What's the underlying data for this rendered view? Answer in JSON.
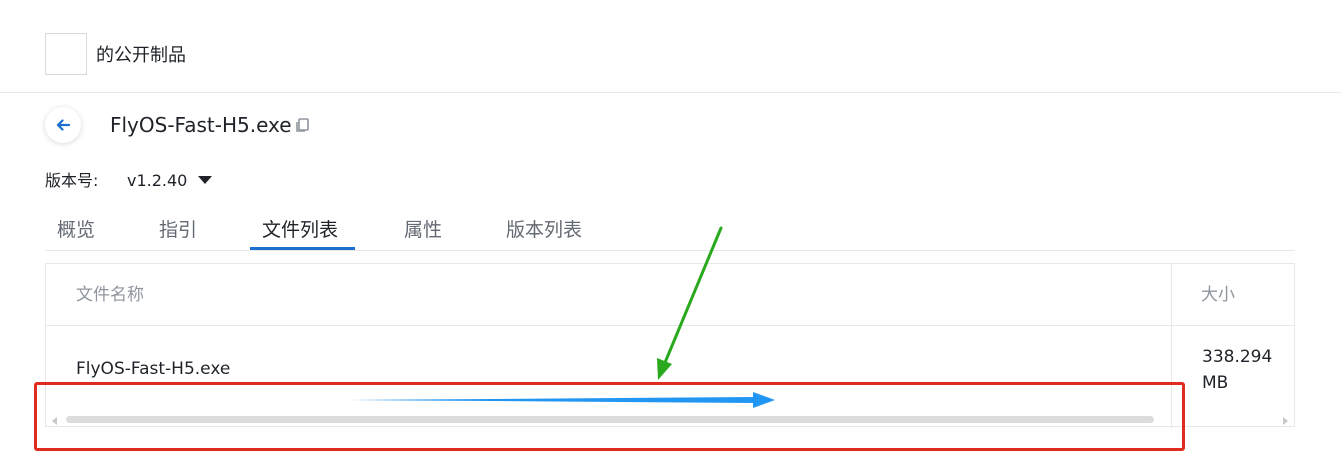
{
  "header": {
    "title": "的公开制品"
  },
  "artifact": {
    "name": "FlyOS-Fast-H5.exe"
  },
  "version": {
    "label": "版本号:",
    "value": "v1.2.40"
  },
  "tabs": [
    {
      "label": "概览",
      "active": false
    },
    {
      "label": "指引",
      "active": false
    },
    {
      "label": "文件列表",
      "active": true
    },
    {
      "label": "属性",
      "active": false
    },
    {
      "label": "版本列表",
      "active": false
    }
  ],
  "table": {
    "columns": [
      "文件名称",
      "大小"
    ],
    "rows": [
      {
        "name": "FlyOS-Fast-H5.exe",
        "size_value": "338.294",
        "size_unit": "MB"
      }
    ]
  },
  "icons": {
    "back": "arrow-left-icon",
    "copy": "copy-icon",
    "caret": "caret-down-icon"
  },
  "colors": {
    "accent": "#1c6fd1",
    "annotation_box": "#e02b20",
    "annotation_green_arrow": "#2aa81e",
    "annotation_blue_arrow": "#2196f3"
  }
}
